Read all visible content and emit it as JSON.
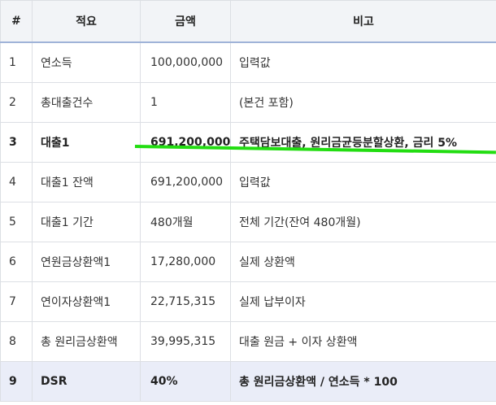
{
  "table": {
    "headers": [
      "#",
      "적요",
      "금액",
      "비고"
    ],
    "rows": [
      {
        "no": "1",
        "item": "연소득",
        "amount": "100,000,000",
        "note": "입력값"
      },
      {
        "no": "2",
        "item": "총대출건수",
        "amount": "1",
        "note": "(본건 포함)"
      },
      {
        "no": "3",
        "item": "대출1",
        "amount": "691,200,000",
        "note": "주택담보대출, 원리금균등분할상환, 금리 5%"
      },
      {
        "no": "4",
        "item": "대출1 잔액",
        "amount": "691,200,000",
        "note": "입력값"
      },
      {
        "no": "5",
        "item": "대출1 기간",
        "amount": "480개월",
        "note": "전체 기간(잔여 480개월)"
      },
      {
        "no": "6",
        "item": "연원금상환액1",
        "amount": "17,280,000",
        "note": "실제 상환액"
      },
      {
        "no": "7",
        "item": "연이자상환액1",
        "amount": "22,715,315",
        "note": "실제 납부이자"
      },
      {
        "no": "8",
        "item": "총 원리금상환액",
        "amount": "39,995,315",
        "note": "대출 원금 + 이자 상환액"
      },
      {
        "no": "9",
        "item": "DSR",
        "amount": "40%",
        "note": "총 원리금상환액 / 연소득 * 100"
      }
    ]
  },
  "colors": {
    "header_bg": "#f2f4f7",
    "highlight_row_bg": "#eaedf8",
    "marker_line": "#22dd11",
    "border": "#dcdfe4"
  }
}
